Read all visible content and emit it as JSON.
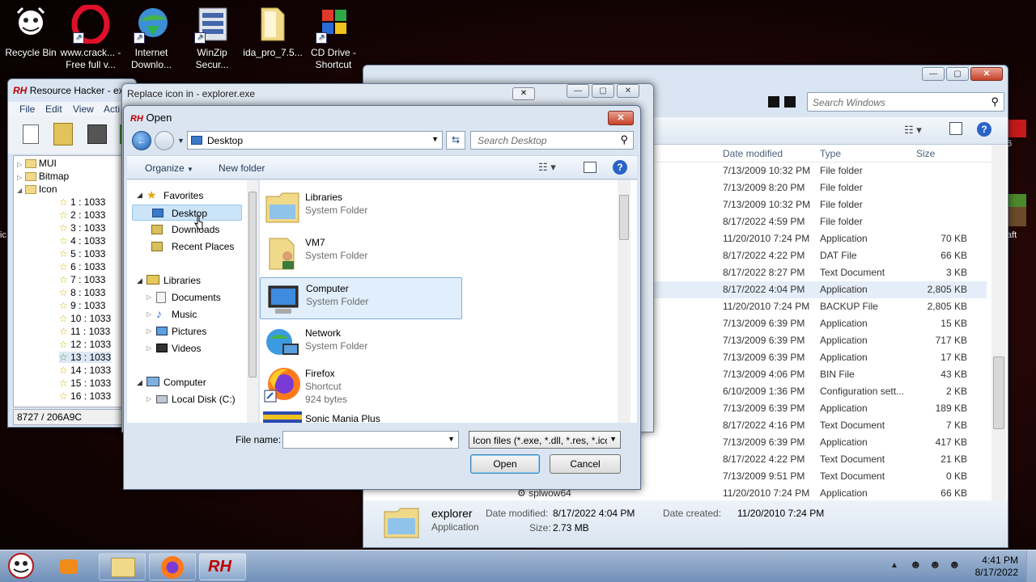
{
  "desktop": {
    "icons": [
      {
        "label": "Recycle Bin",
        "name": "recycle-bin-icon"
      },
      {
        "label": "www.crack... - Free full v...",
        "name": "opera-browser-icon"
      },
      {
        "label": "Internet Downlo...",
        "name": "internet-download-manager-icon"
      },
      {
        "label": "WinZip Secur...",
        "name": "winzip-icon"
      },
      {
        "label": "ida_pro_7.5...",
        "name": "folder-icon"
      },
      {
        "label": "CD Drive - Shortcut",
        "name": "cd-drive-icon"
      }
    ],
    "right_edge_labels": [
      "6",
      "aft"
    ],
    "left_edge_label": "ic"
  },
  "resource_hacker": {
    "title": "Resource Hacker - ex",
    "menu": [
      "File",
      "Edit",
      "View",
      "Acti"
    ],
    "tree": {
      "top": [
        "MUI",
        "Bitmap",
        "Icon"
      ],
      "items": [
        "1 : 1033",
        "2 : 1033",
        "3 : 1033",
        "4 : 1033",
        "5 : 1033",
        "6 : 1033",
        "7 : 1033",
        "8 : 1033",
        "9 : 1033",
        "10 : 1033",
        "11 : 1033",
        "12 : 1033",
        "13 : 1033",
        "14 : 1033",
        "15 : 1033",
        "16 : 1033"
      ]
    },
    "status": "8727 / 206A9C"
  },
  "replace_icon": {
    "title": "Replace icon in - explorer.exe"
  },
  "explorer": {
    "search_placeholder": "Search Windows",
    "columns": [
      "Date modified",
      "Type",
      "Size"
    ],
    "rows": [
      {
        "date": "7/13/2009 10:32 PM",
        "type": "File folder",
        "size": ""
      },
      {
        "date": "7/13/2009 8:20 PM",
        "type": "File folder",
        "size": ""
      },
      {
        "date": "7/13/2009 10:32 PM",
        "type": "File folder",
        "size": ""
      },
      {
        "date": "8/17/2022 4:59 PM",
        "type": "File folder",
        "size": ""
      },
      {
        "date": "11/20/2010 7:24 PM",
        "type": "Application",
        "size": "70 KB"
      },
      {
        "date": "8/17/2022 4:22 PM",
        "type": "DAT File",
        "size": "66 KB"
      },
      {
        "date": "8/17/2022 8:27 PM",
        "type": "Text Document",
        "size": "3 KB"
      },
      {
        "date": "8/17/2022 4:04 PM",
        "type": "Application",
        "size": "2,805 KB"
      },
      {
        "date": "11/20/2010 7:24 PM",
        "type": "BACKUP File",
        "size": "2,805 KB"
      },
      {
        "date": "7/13/2009 6:39 PM",
        "type": "Application",
        "size": "15 KB"
      },
      {
        "date": "7/13/2009 6:39 PM",
        "type": "Application",
        "size": "717 KB"
      },
      {
        "date": "7/13/2009 6:39 PM",
        "type": "Application",
        "size": "17 KB"
      },
      {
        "date": "7/13/2009 4:06 PM",
        "type": "BIN File",
        "size": "43 KB"
      },
      {
        "date": "6/10/2009 1:36 PM",
        "type": "Configuration sett...",
        "size": "2 KB"
      },
      {
        "date": "7/13/2009 6:39 PM",
        "type": "Application",
        "size": "189 KB"
      },
      {
        "date": "8/17/2022 4:16 PM",
        "type": "Text Document",
        "size": "7 KB"
      },
      {
        "date": "7/13/2009 6:39 PM",
        "type": "Application",
        "size": "417 KB"
      },
      {
        "date": "8/17/2022 4:22 PM",
        "type": "Text Document",
        "size": "21 KB"
      },
      {
        "date": "7/13/2009 9:51 PM",
        "type": "Text Document",
        "size": "0 KB"
      },
      {
        "date": "11/20/2010 7:24 PM",
        "type": "Application",
        "size": "66 KB"
      }
    ],
    "partial_name": "splwow64",
    "details": {
      "name": "explorer",
      "type": "Application",
      "date_modified_label": "Date modified:",
      "date_modified": "8/17/2022 4:04 PM",
      "date_created_label": "Date created:",
      "date_created": "11/20/2010 7:24 PM",
      "size_label": "Size:",
      "size": "2.73 MB"
    }
  },
  "open_dialog": {
    "title": "Open",
    "address": "Desktop",
    "search_placeholder": "Search Desktop",
    "organize": "Organize",
    "new_folder": "New folder",
    "nav": {
      "favorites": "Favorites",
      "fav_items": [
        "Desktop",
        "Downloads",
        "Recent Places"
      ],
      "libraries": "Libraries",
      "lib_items": [
        "Documents",
        "Music",
        "Pictures",
        "Videos"
      ],
      "computer": "Computer",
      "comp_items": [
        "Local Disk (C:)"
      ]
    },
    "files": [
      {
        "name": "Libraries",
        "sub": "System Folder"
      },
      {
        "name": "VM7",
        "sub": "System Folder"
      },
      {
        "name": "Computer",
        "sub": "System Folder"
      },
      {
        "name": "Network",
        "sub": "System Folder"
      },
      {
        "name": "Firefox",
        "sub": "Shortcut",
        "sub2": "924 bytes"
      },
      {
        "name": "Sonic Mania Plus",
        "sub": ""
      }
    ],
    "file_name_label": "File name:",
    "file_name_value": "",
    "filter": "Icon files (*.exe, *.dll, *.res, *.ico",
    "open_button": "Open",
    "cancel_button": "Cancel"
  },
  "taskbar": {
    "time": "4:41 PM",
    "date": "8/17/2022"
  }
}
